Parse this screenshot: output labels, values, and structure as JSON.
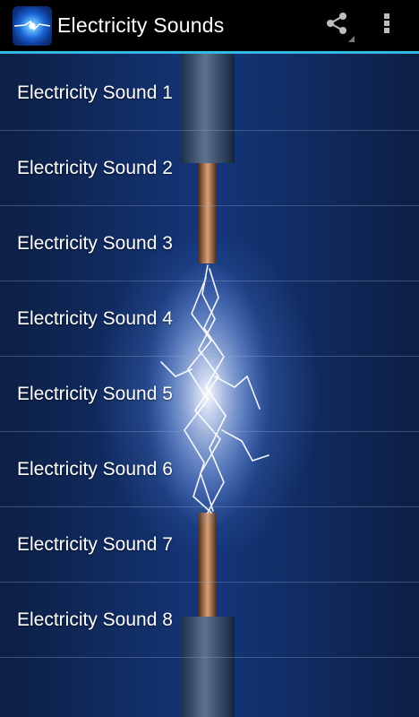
{
  "actionbar": {
    "title": "Electricity Sounds",
    "app_icon": "lightning-app-icon",
    "share_icon": "share-icon",
    "overflow_icon": "overflow-menu-icon",
    "accent_color": "#33b5e5"
  },
  "sounds": [
    {
      "label": "Electricity Sound 1"
    },
    {
      "label": "Electricity Sound 2"
    },
    {
      "label": "Electricity Sound 3"
    },
    {
      "label": "Electricity Sound 4"
    },
    {
      "label": "Electricity Sound 5"
    },
    {
      "label": "Electricity Sound 6"
    },
    {
      "label": "Electricity Sound 7"
    },
    {
      "label": "Electricity Sound 8"
    }
  ]
}
